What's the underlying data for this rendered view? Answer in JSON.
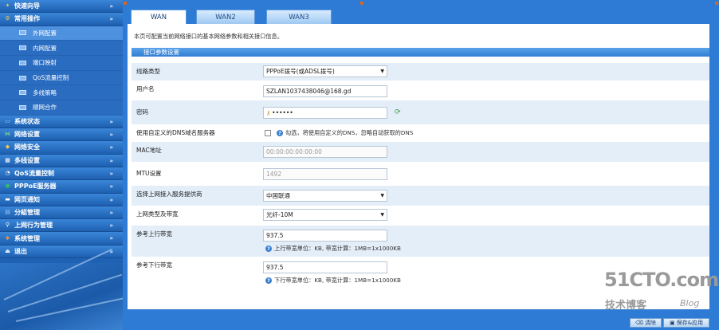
{
  "sidebar": {
    "groups_top": [
      {
        "label": "快速向导",
        "icon": "wizard-icon"
      },
      {
        "label": "常用操作",
        "icon": "settings-gear-icon"
      }
    ],
    "sub_items": [
      {
        "label": "外网配置",
        "active": true
      },
      {
        "label": "内网配置",
        "active": false
      },
      {
        "label": "端口映射",
        "active": false
      },
      {
        "label": "QoS流量控制",
        "active": false
      },
      {
        "label": "多线策略",
        "active": false
      },
      {
        "label": "順网合作",
        "active": false
      }
    ],
    "groups_bottom": [
      {
        "label": "系统状态",
        "icon": "monitor-icon"
      },
      {
        "label": "网络设置",
        "icon": "network-icon"
      },
      {
        "label": "网络安全",
        "icon": "shield-icon"
      },
      {
        "label": "多线设置",
        "icon": "multiline-icon"
      },
      {
        "label": "QoS流量控制",
        "icon": "qos-icon"
      },
      {
        "label": "PPPoE服务器",
        "icon": "pppoe-icon"
      },
      {
        "label": "网页通知",
        "icon": "notice-icon"
      },
      {
        "label": "分組管理",
        "icon": "group-icon"
      },
      {
        "label": "上网行为管理",
        "icon": "behavior-icon"
      },
      {
        "label": "系统管理",
        "icon": "system-icon"
      },
      {
        "label": "退出",
        "icon": "exit-icon"
      }
    ],
    "expand_glyph": "»"
  },
  "tabs": [
    {
      "label": "WAN",
      "active": true
    },
    {
      "label": "WAN2",
      "active": false
    },
    {
      "label": "WAN3",
      "active": false
    }
  ],
  "content": {
    "description": "本页可配置当前网络接口的基本网络参数和相关接口信息。",
    "section_title": "接口参数设置"
  },
  "form": {
    "line_type": {
      "label": "线路类型",
      "value": "PPPoE拨号(或ADSL拨号)"
    },
    "username": {
      "label": "用户名",
      "value": "SZLAN1037438046@168.gd"
    },
    "password": {
      "label": "密码",
      "value": "••••••"
    },
    "dns": {
      "label": "使用自定义的DNS域名服务器",
      "hint": "勾选，将使用自定义的DNS，忽略自动获取的DNS",
      "checked": false
    },
    "mac": {
      "label": "MAC地址",
      "placeholder": "00:00:00:00:00:00"
    },
    "mtu": {
      "label": "MTU设置",
      "value": "1492"
    },
    "isp": {
      "label": "选择上网接入服务提供商",
      "value": "中国联通"
    },
    "bandwidth_type": {
      "label": "上网类型及带宽",
      "value": "光纤-10M"
    },
    "upload": {
      "label": "参考上行带宽",
      "value": "937.5",
      "hint": "上行带宽单位：KB, 带宽计算：1MB=1x1000KB"
    },
    "download": {
      "label": "参考下行带宽",
      "value": "937.5",
      "hint": "下行带宽单位：KB, 带宽计算：1MB=1x1000KB"
    }
  },
  "buttons": {
    "clear": "清除",
    "save": "保存&应用"
  },
  "watermark": {
    "site": "51CTO.com",
    "cn": "技术博客",
    "blog": "Blog"
  },
  "colors": {
    "frame_blue": "#2d7bd4",
    "row_alt": "#e3eef9",
    "accent_orange": "#d9661f"
  }
}
